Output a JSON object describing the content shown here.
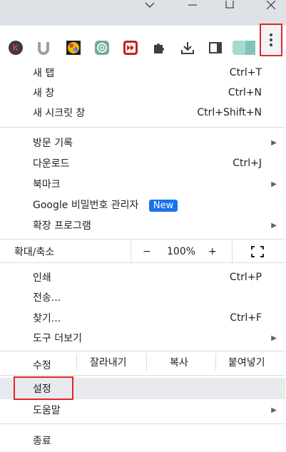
{
  "window": {
    "controls": [
      "minimize-icon",
      "maximize-icon",
      "close-icon"
    ]
  },
  "toolbar": {
    "extensions": [
      "k-extension-icon",
      "u-extension-icon",
      "colorful-extension-icon",
      "openai-extension-icon",
      "fast-forward-extension-icon",
      "puzzle-icon",
      "download-icon",
      "side-panel-icon",
      "profile-avatar-icon"
    ],
    "menu_icon": "three-dots-vertical-icon"
  },
  "menu": {
    "new_tab": {
      "label": "새 탭",
      "accel": "Ctrl+T"
    },
    "new_window": {
      "label": "새 창",
      "accel": "Ctrl+N"
    },
    "incognito": {
      "label": "새 시크릿 창",
      "accel": "Ctrl+Shift+N"
    },
    "history": {
      "label": "방문 기록"
    },
    "downloads": {
      "label": "다운로드",
      "accel": "Ctrl+J"
    },
    "bookmarks": {
      "label": "북마크"
    },
    "password_manager": {
      "label": "Google 비밀번호 관리자",
      "badge": "New"
    },
    "extensions": {
      "label": "확장 프로그램"
    },
    "zoom": {
      "label": "확대/축소",
      "minus": "−",
      "value": "100%",
      "plus": "+"
    },
    "print": {
      "label": "인쇄",
      "accel": "Ctrl+P"
    },
    "cast": {
      "label": "전송..."
    },
    "find": {
      "label": "찾기...",
      "accel": "Ctrl+F"
    },
    "more_tools": {
      "label": "도구 더보기"
    },
    "edit": {
      "label": "수정",
      "cut": "잘라내기",
      "copy": "복사",
      "paste": "붙여넣기"
    },
    "settings": {
      "label": "설정"
    },
    "help": {
      "label": "도움말"
    },
    "exit": {
      "label": "종료"
    }
  },
  "colors": {
    "highlight_border": "#e3252c",
    "badge_bg": "#1a73e8"
  }
}
